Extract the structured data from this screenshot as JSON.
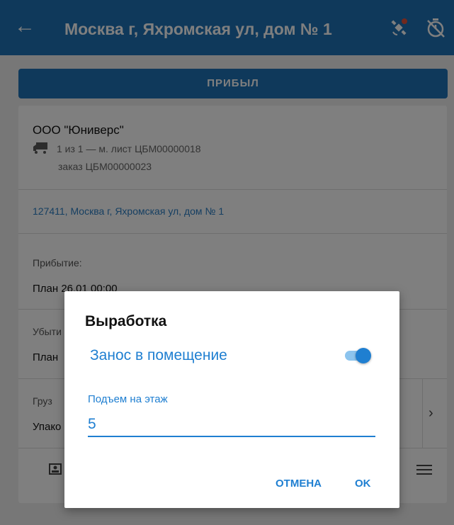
{
  "app_bar": {
    "back_icon": "arrow-left-icon",
    "title": "Москва г, Яхромская ул, дом № 1",
    "satellite_icon": "satellite-icon",
    "timer_icon": "timer-off-icon",
    "bar_color": "#1e72b7"
  },
  "arrive_button": {
    "label": "ПРИБЫЛ"
  },
  "card": {
    "company": "ООО \"Юниверс\"",
    "truck_icon": "truck-icon",
    "route": "1 из 1 — м. лист ЦБМ00000018",
    "order": "заказ ЦБМ00000023",
    "address": "127411, Москва г, Яхромская ул, дом № 1",
    "arrival": {
      "label": "Прибытие:",
      "value": "План  26.01 00:00"
    },
    "departure": {
      "label": "Убыти",
      "value": "План"
    },
    "cargo": {
      "label": "Груз",
      "value": "Упако"
    },
    "chevron_icon": "chevron-right-icon",
    "bottom_left_icon": "contact-card-icon",
    "bottom_right_icon": "list-icon"
  },
  "dialog": {
    "title": "Выработка",
    "switch_label": "Занос в помещение",
    "switch_on": true,
    "field_label": "Подъем на этаж",
    "field_value": "5",
    "cancel_label": "ОТМЕНА",
    "ok_label": "OK",
    "accent_color": "#1f7fd1"
  }
}
